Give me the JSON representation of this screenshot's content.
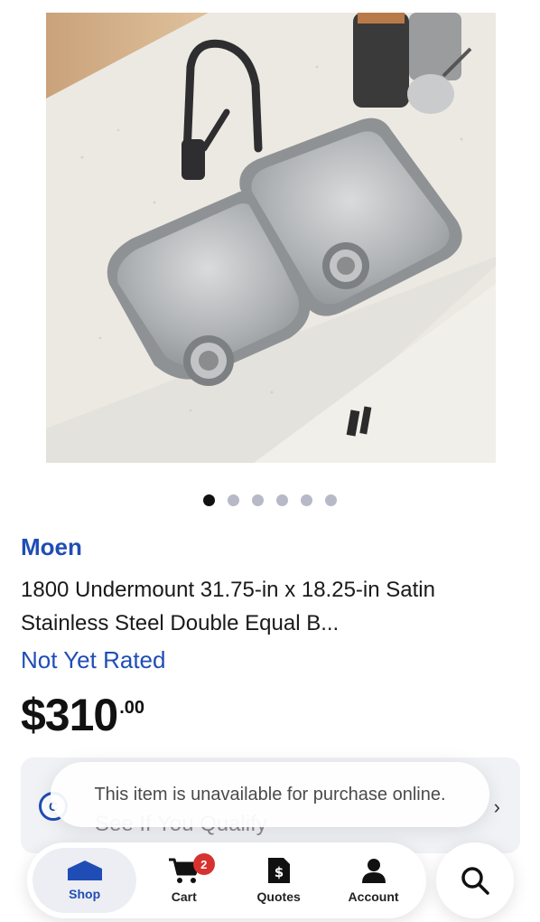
{
  "gallery": {
    "slide_count": 6,
    "active_index": 0
  },
  "product": {
    "brand": "Moen",
    "title": "1800 Undermount 31.75-in x 18.25-in Satin Stainless Steel Double Equal B...",
    "rating": "Not Yet Rated",
    "price_main": "$310",
    "price_cents": ".00"
  },
  "financing_card": {
    "icon_label": "C",
    "text": "See If You Qualify",
    "chevron": "›"
  },
  "toast": {
    "message": "This item is unavailable for purchase online."
  },
  "tabbar": {
    "tabs": [
      {
        "label": "Shop",
        "icon": "home-icon"
      },
      {
        "label": "Cart",
        "icon": "cart-icon",
        "badge": "2"
      },
      {
        "label": "Quotes",
        "icon": "quote-document-icon"
      },
      {
        "label": "Account",
        "icon": "person-icon"
      }
    ],
    "search_icon": "search-icon"
  },
  "colors": {
    "brand_blue": "#1f4db5",
    "badge_red": "#d6322f"
  }
}
